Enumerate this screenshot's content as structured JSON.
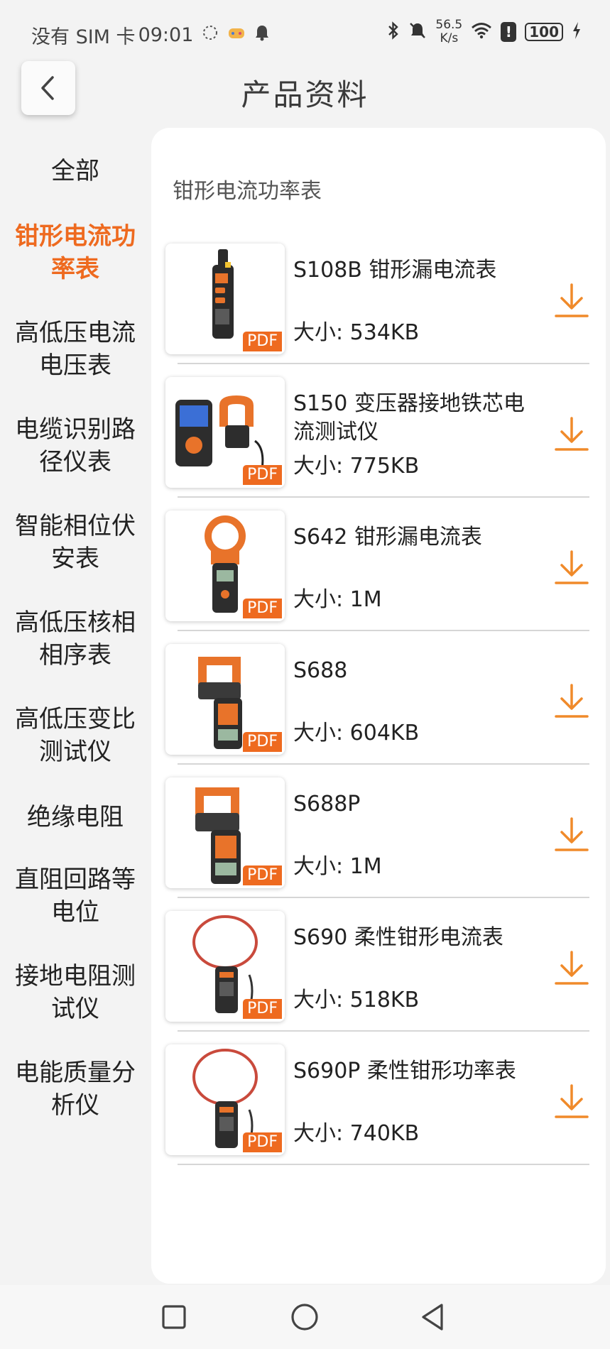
{
  "status_bar": {
    "carrier": "没有 SIM 卡",
    "time": "09:01",
    "net_speed_value": "56.5",
    "net_speed_unit": "K/s",
    "battery": "100",
    "alert": "!"
  },
  "header": {
    "title": "产品资料"
  },
  "sidebar": {
    "items": [
      {
        "label": "全部",
        "active": false
      },
      {
        "label": "钳形电流功率表",
        "active": true
      },
      {
        "label": "高低压电流电压表",
        "active": false
      },
      {
        "label": "电缆识别路径仪表",
        "active": false
      },
      {
        "label": "智能相位伏安表",
        "active": false
      },
      {
        "label": "高低压核相相序表",
        "active": false
      },
      {
        "label": "高低压变比测试仪",
        "active": false
      },
      {
        "label": "绝缘电阻",
        "active": false
      },
      {
        "label": "直阻回路等电位",
        "active": false
      },
      {
        "label": "接地电阻测试仪",
        "active": false
      },
      {
        "label": "电能质量分析仪",
        "active": false
      }
    ]
  },
  "content": {
    "section_title": "钳形电流功率表",
    "documents": [
      {
        "name": "S108B 钳形漏电流表",
        "size": "大小: 534KB",
        "badge": "PDF"
      },
      {
        "name": "S150 变压器接地铁芯电流测试仪",
        "size": "大小: 775KB",
        "badge": "PDF"
      },
      {
        "name": "S642 钳形漏电流表",
        "size": "大小: 1M",
        "badge": "PDF"
      },
      {
        "name": "S688",
        "size": "大小: 604KB",
        "badge": "PDF"
      },
      {
        "name": "S688P",
        "size": "大小: 1M",
        "badge": "PDF"
      },
      {
        "name": "S690 柔性钳形电流表",
        "size": "大小: 518KB",
        "badge": "PDF"
      },
      {
        "name": "S690P 柔性钳形功率表",
        "size": "大小: 740KB",
        "badge": "PDF"
      }
    ]
  },
  "icons": {
    "back": "chevron-left-icon",
    "download": "download-icon",
    "nav_recent": "square-icon",
    "nav_home": "circle-icon",
    "nav_back": "triangle-back-icon"
  },
  "colors": {
    "accent": "#ee6a1f",
    "background": "#f3f3f3",
    "panel": "#ffffff"
  }
}
